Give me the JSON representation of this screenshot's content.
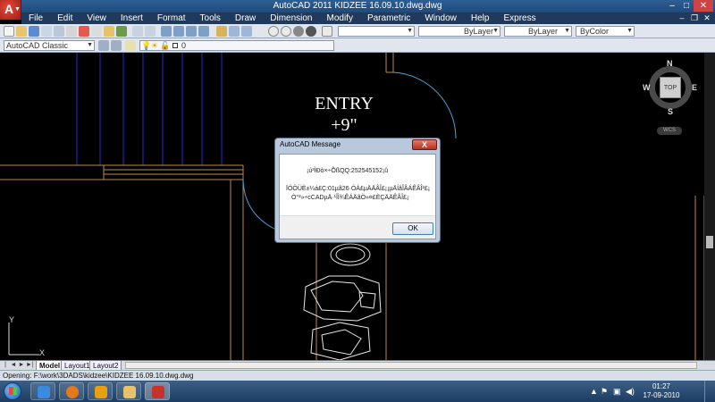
{
  "window": {
    "title": "AutoCAD 2011    KIDZEE 16.09.10.dwg.dwg",
    "app_button": "A"
  },
  "menu": {
    "items": [
      "File",
      "Edit",
      "View",
      "Insert",
      "Format",
      "Tools",
      "Draw",
      "Dimension",
      "Modify",
      "Parametric",
      "Window",
      "Help",
      "Express"
    ]
  },
  "toolbar": {
    "workspace": "AutoCAD Classic",
    "layer_value": "0",
    "linetype": "ByLayer",
    "lineweight": "ByLayer",
    "color": "ByColor"
  },
  "drawing": {
    "entry_line1": "ENTRY",
    "entry_line2": "+9\""
  },
  "viewcube": {
    "n": "N",
    "s": "S",
    "e": "E",
    "w": "W",
    "face": "TOP",
    "wcs": "WCS"
  },
  "ucs": {
    "y": "Y",
    "x": "X"
  },
  "layout_tabs": {
    "nav": [
      "|◄",
      "◄",
      "►",
      "►|"
    ],
    "tabs": [
      "Model",
      "Layout1",
      "Layout2"
    ],
    "active": "Model"
  },
  "status": {
    "text": "Opening: F:\\work\\3DADS\\kidzee\\KIDZEE 16.09.10.dwg.dwg"
  },
  "dialog": {
    "title": "AutoCAD Message",
    "close": "X",
    "line1": "¡ú³ÌÐò×÷ÕßQQ:252545152¡û",
    "line2": "ÏÖÖÜÈ±¼á£Ç:01µã26·ÓÁ£µÄÄÂÎ£¡¡µÄÍâÎÂÁÊÂÎ²£¡",
    "line3": "Ò°²»÷cCADµÄ·¹ÎÌ¾ÊÁÄãÖ»¤£ÈÇÄÄÊÂÎ£¡",
    "ok": "OK"
  },
  "taskbar": {
    "clock_time": "01:27",
    "clock_date": "17-09-2010"
  },
  "colors": {
    "canvas": "#000000",
    "title_bar": "#1f4a7c",
    "menu_bar": "#1f3a5c",
    "wall_lines": "#c08a4a",
    "door_arc": "#4ba3d6",
    "hatch_lines": "#2a2ad0",
    "dialog_frame": "#b9c9dc"
  }
}
